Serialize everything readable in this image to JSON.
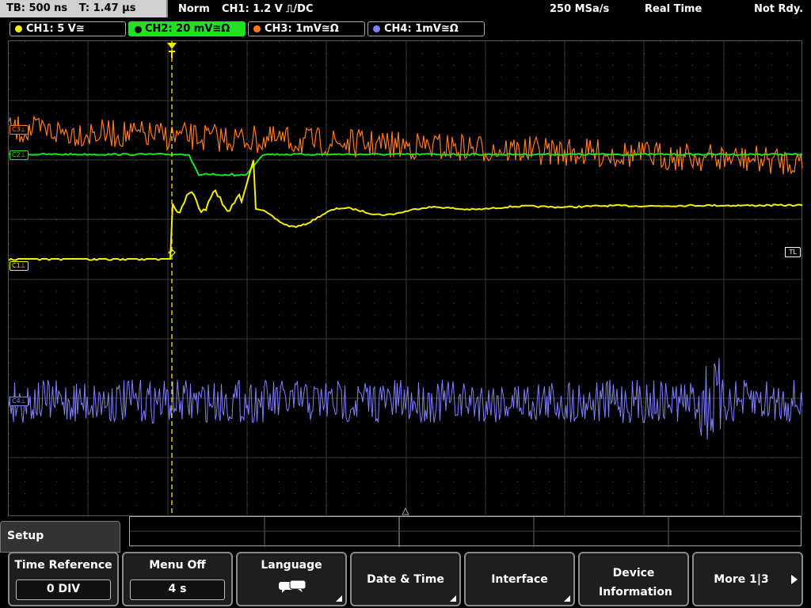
{
  "topbar": {
    "timebase": "TB: 500 ns",
    "trigger_time": "T: 1.47 µs",
    "trigger_mode": "Norm",
    "trigger_source": "CH1: 1.2 V ⎍/DC",
    "sample_rate": "250 MSa/s",
    "acq_mode": "Real Time",
    "status": "Not Rdy."
  },
  "channels": [
    {
      "label": "CH1: 5 V≅",
      "color": "#f5f000",
      "active": false
    },
    {
      "label": "CH2: 20 mV≅Ω",
      "color": "#22e024",
      "active": true
    },
    {
      "label": "CH3: 1mV≅Ω",
      "color": "#ff7a1a",
      "active": false
    },
    {
      "label": "CH4: 1mV≅Ω",
      "color": "#8080ff",
      "active": false
    }
  ],
  "markers": {
    "c1": "C1⊥",
    "c2": "C2⊥",
    "c3": "C3⊥",
    "c4": "C4⊥",
    "tl": "TL"
  },
  "menu": {
    "title": "Setup",
    "softkeys": [
      {
        "label": "Time Reference",
        "value": "0 DIV"
      },
      {
        "label": "Menu Off",
        "value": "4 s"
      },
      {
        "label": "Language",
        "icon": "speech-bubbles-icon"
      },
      {
        "label": "Date & Time"
      },
      {
        "label": "Interface"
      },
      {
        "label": "Device Information"
      },
      {
        "label": "More 1|3"
      }
    ]
  }
}
